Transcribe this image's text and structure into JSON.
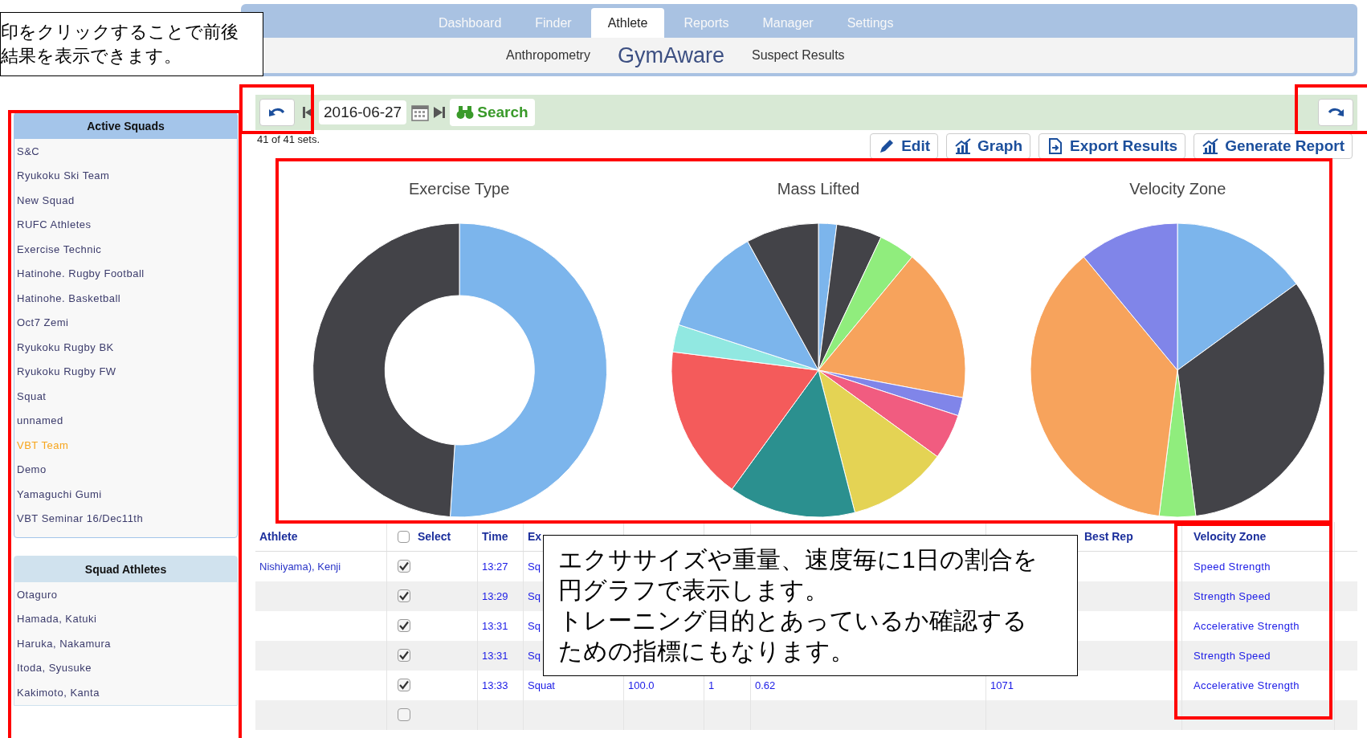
{
  "note_top": {
    "lines": [
      "印をクリックすることで前後",
      "結果を表示できます。"
    ]
  },
  "nav": {
    "tabs": [
      {
        "label": "Dashboard",
        "selected": false
      },
      {
        "label": "Finder",
        "selected": false
      },
      {
        "label": "Athlete",
        "selected": true
      },
      {
        "label": "Reports",
        "selected": false
      },
      {
        "label": "Manager",
        "selected": false
      },
      {
        "label": "Settings",
        "selected": false
      }
    ],
    "subtabs": [
      {
        "label": "Anthropometry",
        "kind": "link"
      },
      {
        "label": "GymAware",
        "kind": "brand"
      },
      {
        "label": "Suspect Results",
        "kind": "link"
      }
    ]
  },
  "toolbar": {
    "date": "2016-06-27",
    "search": "Search"
  },
  "sets_count": "41 of 41 sets.",
  "actions": [
    "Edit",
    "Graph",
    "Export Results",
    "Generate Report"
  ],
  "sidebar": {
    "active_squads": {
      "title": "Active Squads",
      "items": [
        {
          "label": "S&C",
          "selected": false
        },
        {
          "label": "Ryukoku Ski Team",
          "selected": false
        },
        {
          "label": "New Squad",
          "selected": false
        },
        {
          "label": "RUFC Athletes",
          "selected": false
        },
        {
          "label": "Exercise Technic",
          "selected": false
        },
        {
          "label": "Hatinohe. Rugby Football",
          "selected": false
        },
        {
          "label": "Hatinohe. Basketball",
          "selected": false
        },
        {
          "label": "Oct7 Zemi",
          "selected": false
        },
        {
          "label": "Ryukoku Rugby BK",
          "selected": false
        },
        {
          "label": "Ryukoku Rugby FW",
          "selected": false
        },
        {
          "label": "Squat",
          "selected": false
        },
        {
          "label": "unnamed",
          "selected": false
        },
        {
          "label": "VBT Team",
          "selected": true
        },
        {
          "label": "Demo",
          "selected": false
        },
        {
          "label": "Yamaguchi Gumi",
          "selected": false
        },
        {
          "label": "VBT Seminar 16/Dec11th",
          "selected": false
        }
      ]
    },
    "squad_athletes": {
      "title": "Squad Athletes",
      "items": [
        "Otaguro",
        "Hamada, Katuki",
        "Haruka, Nakamura",
        "Itoda, Syusuke",
        "Kakimoto, Kanta"
      ]
    }
  },
  "charts": [
    {
      "title": "Exercise Type",
      "kind": "donut"
    },
    {
      "title": "Mass Lifted",
      "kind": "pie"
    },
    {
      "title": "Velocity Zone",
      "kind": "pie"
    }
  ],
  "table": {
    "columns": [
      "Athlete",
      "Select",
      "Time",
      "Ex",
      "",
      "",
      "",
      "Best Rep",
      "Velocity Zone"
    ],
    "select_all": {
      "checked": false
    },
    "rows": [
      {
        "athlete": "Nishiyama), Kenji",
        "checked": true,
        "time": "13:27",
        "column_4": "Sq",
        "velocity_zone": "Speed Strength"
      },
      {
        "checked": true,
        "time": "13:29",
        "column_4": "Sq",
        "velocity_zone": "Strength Speed"
      },
      {
        "checked": true,
        "time": "13:31",
        "column_4": "Sq",
        "velocity_zone": "Accelerative Strength"
      },
      {
        "checked": true,
        "time": "13:31",
        "column_4": "Sq",
        "velocity_zone": "Strength Speed"
      },
      {
        "checked": true,
        "time": "13:33",
        "column_4": "Squat",
        "column_5": "100.0",
        "column_6": "1",
        "column_7": "0.62",
        "column_8": "1071",
        "velocity_zone": "Accelerative Strength"
      },
      {
        "checked": false
      }
    ]
  },
  "note_charts": {
    "lines": [
      "エクササイズや重量、速度毎に1日の割合を",
      "円グラフで表示します。",
      "トレーニング目的とあっているか確認する",
      "ための指標にもなります。"
    ]
  }
}
